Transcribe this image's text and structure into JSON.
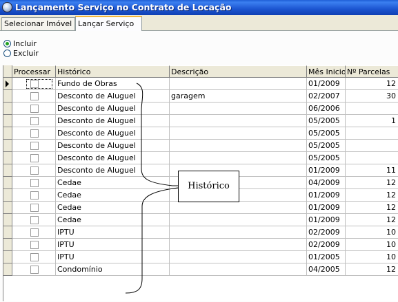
{
  "window": {
    "title": "Lançamento Serviço no Contrato de Locação",
    "icon": "app-globe-icon"
  },
  "tabs": [
    {
      "label": "Selecionar Imóvel",
      "active": false
    },
    {
      "label": "Lançar Serviço",
      "active": true
    }
  ],
  "options": [
    {
      "label": "Incluir",
      "selected": true
    },
    {
      "label": "Excluir",
      "selected": false
    }
  ],
  "grid": {
    "columns": [
      "Processar",
      "Histórico",
      "Descrição",
      "Mês Inicio",
      "Nº Parcelas"
    ],
    "rows": [
      {
        "historico": "Fundo de Obras",
        "descricao": "",
        "mes_inicio": "01/2009",
        "parcelas": "12"
      },
      {
        "historico": "Desconto de Aluguel",
        "descricao": "garagem",
        "mes_inicio": "02/2007",
        "parcelas": "30"
      },
      {
        "historico": "Desconto de Aluguel",
        "descricao": "",
        "mes_inicio": "06/2006",
        "parcelas": ""
      },
      {
        "historico": "Desconto de Aluguel",
        "descricao": "",
        "mes_inicio": "05/2005",
        "parcelas": "1"
      },
      {
        "historico": "Desconto de Aluguel",
        "descricao": "",
        "mes_inicio": "05/2005",
        "parcelas": ""
      },
      {
        "historico": "Desconto de Aluguel",
        "descricao": "",
        "mes_inicio": "05/2005",
        "parcelas": ""
      },
      {
        "historico": "Desconto de Aluguel",
        "descricao": "",
        "mes_inicio": "05/2005",
        "parcelas": ""
      },
      {
        "historico": "Desconto de Aluguel",
        "descricao": "",
        "mes_inicio": "01/2009",
        "parcelas": "11"
      },
      {
        "historico": "Cedae",
        "descricao": "",
        "mes_inicio": "04/2009",
        "parcelas": "12"
      },
      {
        "historico": "Cedae",
        "descricao": "",
        "mes_inicio": "01/2009",
        "parcelas": "12"
      },
      {
        "historico": "Cedae",
        "descricao": "",
        "mes_inicio": "01/2009",
        "parcelas": "12"
      },
      {
        "historico": "Cedae",
        "descricao": "",
        "mes_inicio": "01/2009",
        "parcelas": "12"
      },
      {
        "historico": "IPTU",
        "descricao": "",
        "mes_inicio": "02/2009",
        "parcelas": "10"
      },
      {
        "historico": "IPTU",
        "descricao": "",
        "mes_inicio": "02/2009",
        "parcelas": "10"
      },
      {
        "historico": "IPTU",
        "descricao": "",
        "mes_inicio": "01/2005",
        "parcelas": "10"
      },
      {
        "historico": "Condomínio",
        "descricao": "",
        "mes_inicio": "04/2005",
        "parcelas": "12"
      }
    ]
  },
  "annotation": {
    "label": "Histórico"
  }
}
